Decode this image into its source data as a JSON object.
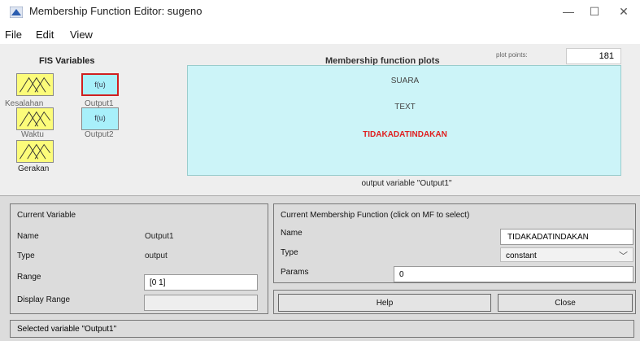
{
  "window": {
    "title": "Membership Function Editor: sugeno",
    "controls": {
      "minimize": "—",
      "maximize": "☐",
      "close": "✕"
    }
  },
  "menu": {
    "items": [
      "File",
      "Edit",
      "View"
    ]
  },
  "fis": {
    "title": "FIS Variables",
    "variables": [
      {
        "label": "Kesalahan",
        "kind": "input"
      },
      {
        "label": "Output1",
        "kind": "output",
        "symbol": "f(u)",
        "selected": true
      },
      {
        "label": "Waktu",
        "kind": "input"
      },
      {
        "label": "Output2",
        "kind": "output",
        "symbol": "f(u)"
      },
      {
        "label": "Gerakan",
        "kind": "input"
      }
    ]
  },
  "plot": {
    "title": "Membership function plots",
    "points_label": "plot points:",
    "points_value": "181",
    "mfs": [
      "SUARA",
      "TEXT",
      "TIDAKADATINDAKAN"
    ],
    "selected_mf": "TIDAKADATINDAKAN",
    "caption": "output variable \"Output1\""
  },
  "current_variable": {
    "header": "Current Variable",
    "name_label": "Name",
    "name_value": "Output1",
    "type_label": "Type",
    "type_value": "output",
    "range_label": "Range",
    "range_value": "[0 1]",
    "display_range_label": "Display Range",
    "display_range_value": ""
  },
  "current_mf": {
    "header": "Current Membership Function (click on MF to select)",
    "name_label": "Name",
    "name_value": "TIDAKADATINDAKAN",
    "type_label": "Type",
    "type_value": "constant",
    "params_label": "Params",
    "params_value": "0"
  },
  "buttons": {
    "help": "Help",
    "close": "Close"
  },
  "status": "Selected variable \"Output1\"",
  "colors": {
    "input_var": "#fcfc7a",
    "output_var": "#a8f0fa",
    "plot_bg": "#ccf4f8",
    "selected": "#e02020"
  }
}
